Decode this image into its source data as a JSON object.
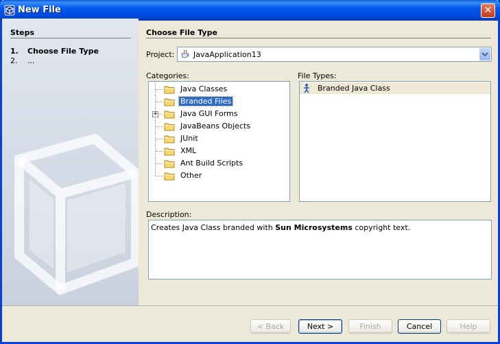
{
  "window": {
    "title": "New File",
    "close_glyph": "✕"
  },
  "steps": {
    "heading": "Steps",
    "items": [
      {
        "num": "1.",
        "label": "Choose File Type"
      },
      {
        "num": "2.",
        "label": "..."
      }
    ]
  },
  "main": {
    "heading": "Choose File Type",
    "project_label": "Project:",
    "project_value": "JavaApplication13",
    "categories_label": "Categories:",
    "categories": [
      {
        "label": "Java Classes",
        "selected": false,
        "expandable": false
      },
      {
        "label": "Branded Files",
        "selected": true,
        "expandable": false
      },
      {
        "label": "Java GUI Forms",
        "selected": false,
        "expandable": true
      },
      {
        "label": "JavaBeans Objects",
        "selected": false,
        "expandable": false
      },
      {
        "label": "JUnit",
        "selected": false,
        "expandable": false
      },
      {
        "label": "XML",
        "selected": false,
        "expandable": false
      },
      {
        "label": "Ant Build Scripts",
        "selected": false,
        "expandable": false
      },
      {
        "label": "Other",
        "selected": false,
        "expandable": false
      }
    ],
    "expander_glyph": "+",
    "filetypes_label": "File Types:",
    "filetypes": [
      {
        "label": "Branded Java Class"
      }
    ],
    "description_label": "Description:",
    "description": {
      "before": "Creates Java Class branded with ",
      "bold": "Sun Microsystems",
      "after": " copyright text."
    }
  },
  "buttons": {
    "back": "< Back",
    "next": "Next >",
    "finish": "Finish",
    "cancel": "Cancel",
    "help": "Help"
  },
  "colors": {
    "titlebar": "#0058ee",
    "selection": "#316ac5",
    "steps_panel": "#c9d1de",
    "dialog_bg": "#ece9d8"
  },
  "icons": {
    "title": "netbeans-cube-icon",
    "project": "java-coffee-cup-icon",
    "folder": "folder-icon",
    "filetype": "bean-figure-icon",
    "combo": "chevron-down-icon",
    "close": "close-icon"
  }
}
